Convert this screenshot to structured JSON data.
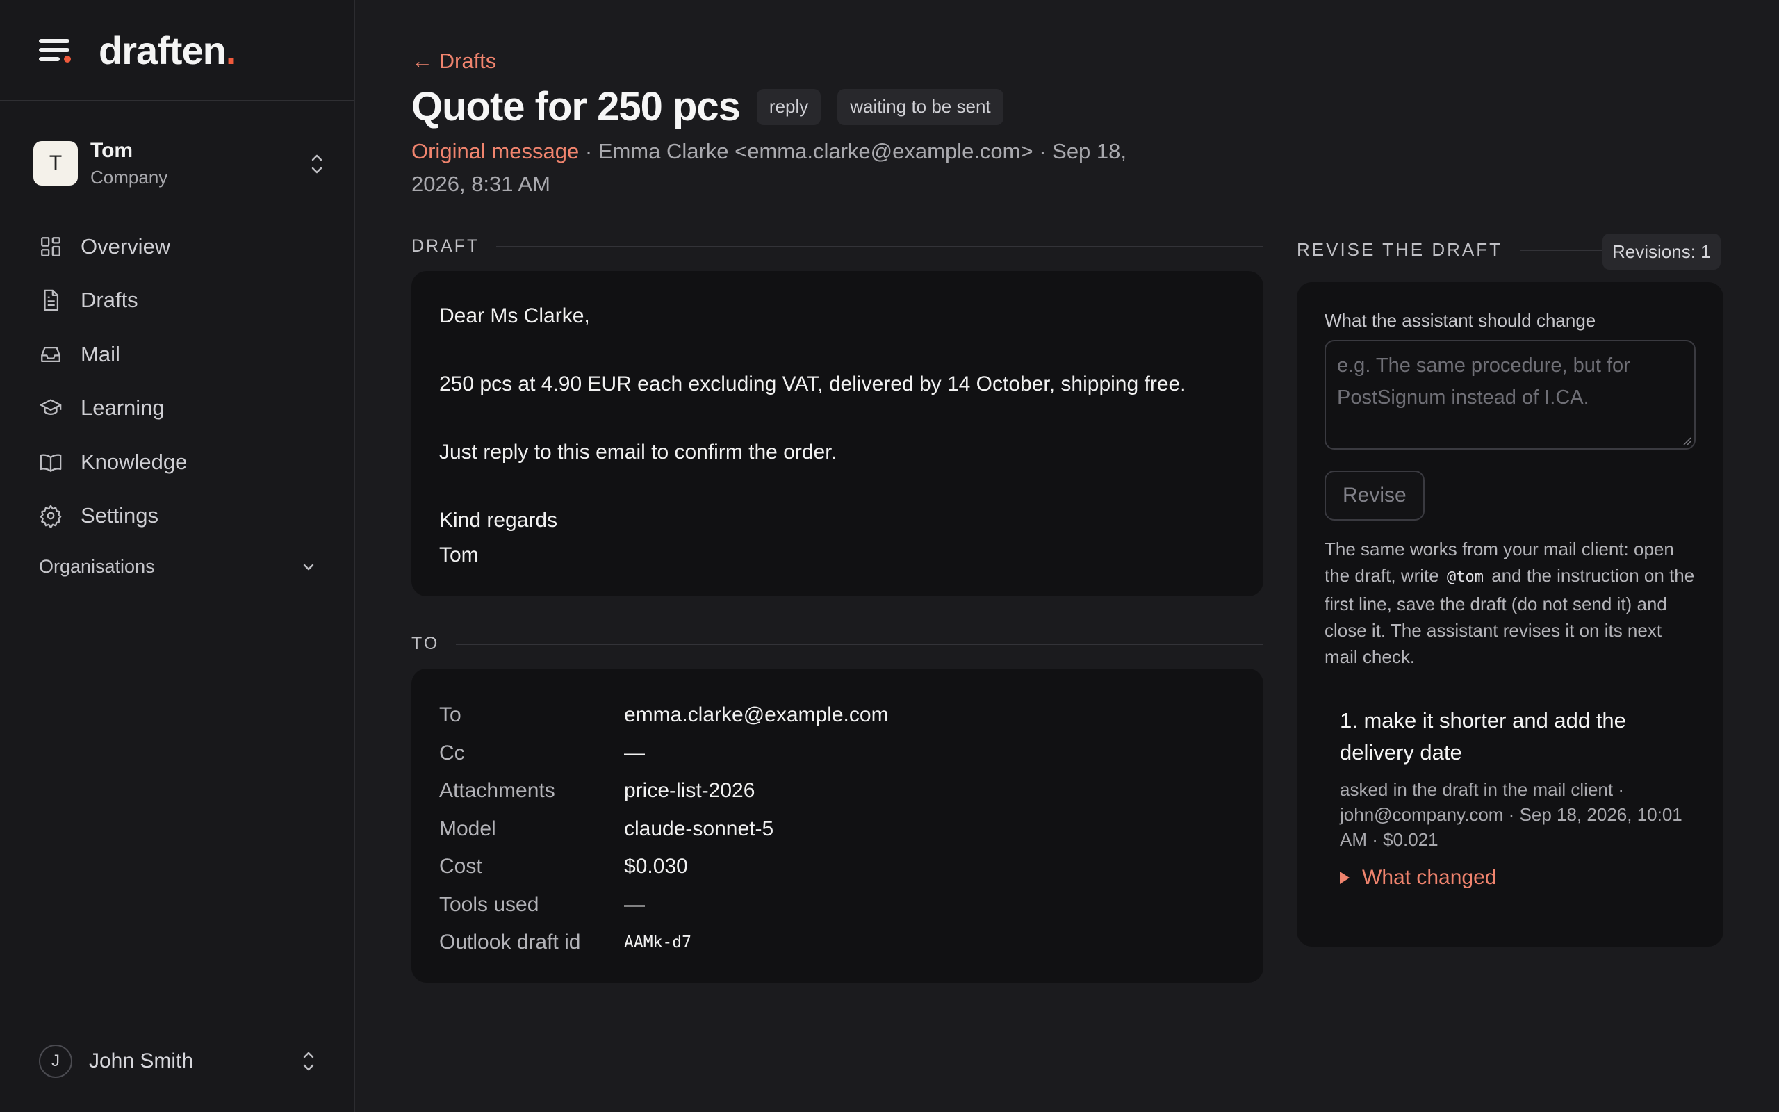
{
  "brand": {
    "logo_text": "draften",
    "logo_dot": "."
  },
  "workspace": {
    "initial": "T",
    "name": "Tom",
    "subtitle": "Company"
  },
  "nav": [
    {
      "label": "Overview",
      "icon": "grid-icon"
    },
    {
      "label": "Drafts",
      "icon": "document-icon"
    },
    {
      "label": "Mail",
      "icon": "inbox-icon"
    },
    {
      "label": "Learning",
      "icon": "graduation-cap-icon"
    },
    {
      "label": "Knowledge",
      "icon": "book-icon"
    },
    {
      "label": "Settings",
      "icon": "gear-icon"
    }
  ],
  "organisations_label": "Organisations",
  "user": {
    "initial": "J",
    "name": "John Smith"
  },
  "header": {
    "back_label": "← Drafts",
    "title": "Quote for 250 pcs",
    "chips": [
      "reply",
      "waiting to be sent"
    ],
    "original_link": "Original message",
    "meta_rest": " · Emma Clarke <emma.clarke@example.com> · Sep 18, 2026, 8:31 AM"
  },
  "draft": {
    "section_label": "DRAFT",
    "greeting": "Dear Ms Clarke,",
    "body1": "250 pcs at 4.90 EUR each excluding VAT, delivered by 14 October, shipping free.",
    "body2": "Just reply to this email to confirm the order.",
    "closing": "Kind regards",
    "signature": "Tom"
  },
  "to": {
    "section_label": "TO",
    "rows": [
      {
        "key": "To",
        "value": "emma.clarke@example.com"
      },
      {
        "key": "Cc",
        "value": "—"
      },
      {
        "key": "Attachments",
        "value": "price-list-2026"
      },
      {
        "key": "Model",
        "value": "claude-sonnet-5"
      },
      {
        "key": "Cost",
        "value": "$0.030"
      },
      {
        "key": "Tools used",
        "value": "—"
      },
      {
        "key": "Outlook draft id",
        "value": "AAMk-d7"
      }
    ]
  },
  "revise": {
    "section_label": "REVISE THE DRAFT",
    "revisions_chip": "Revisions: 1",
    "question": "What the assistant should change",
    "placeholder": "e.g. The same procedure, but for PostSignum instead of I.CA.",
    "button": "Revise",
    "help_before": "The same works from your mail client: open the draft, write",
    "help_code": "@tom",
    "help_after": "and the instruction on the first line, save the draft (do not send it) and close it. The assistant revises it on its next mail check.",
    "item_title": "1. make it shorter and add the delivery date",
    "item_meta": "asked in the draft in the mail client · john@company.com · Sep 18, 2026, 10:01 AM · $0.021",
    "what_changed": "What changed"
  },
  "colors": {
    "accent": "#f0846e",
    "brand_dot": "#ef5a3c",
    "background": "#1b1b1e",
    "card": "#111113"
  }
}
